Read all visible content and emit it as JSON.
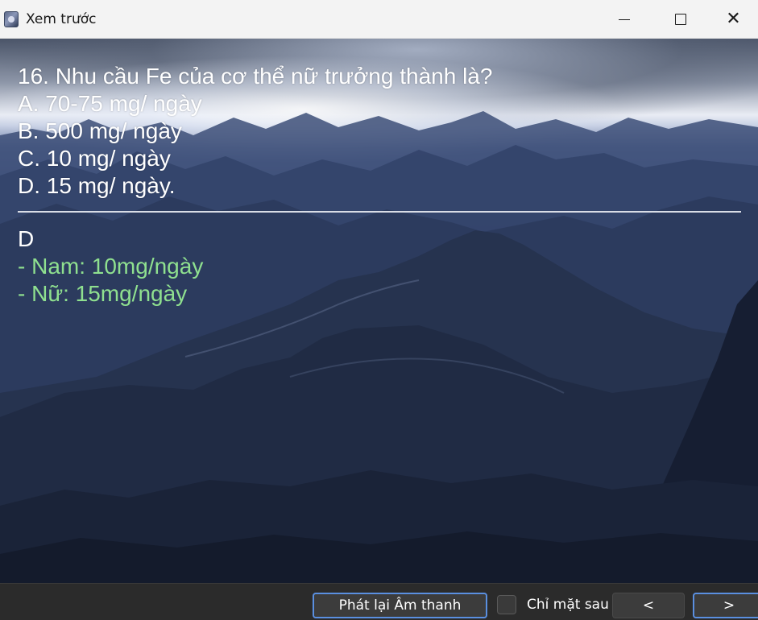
{
  "window": {
    "title": "Xem trước"
  },
  "card": {
    "question": "16. Nhu cầu Fe của cơ thể nữ trưởng thành là?",
    "options": [
      "A. 70-75 mg/ ngày",
      "B. 500 mg/ ngày",
      "C. 10 mg/ ngày",
      "D. 15 mg/ ngày."
    ],
    "answer_letter": "D",
    "answer_notes": [
      "- Nam: 10mg/ngày",
      "- Nữ: 15mg/ngày"
    ],
    "note_color": "#8fe08f"
  },
  "toolbar": {
    "replay_audio_label": "Phát lại Âm thanh",
    "back_only_label": "Chỉ mặt sau",
    "back_only_checked": false,
    "prev_label": "<",
    "next_label": ">",
    "accent_color": "#5a8fe0"
  }
}
